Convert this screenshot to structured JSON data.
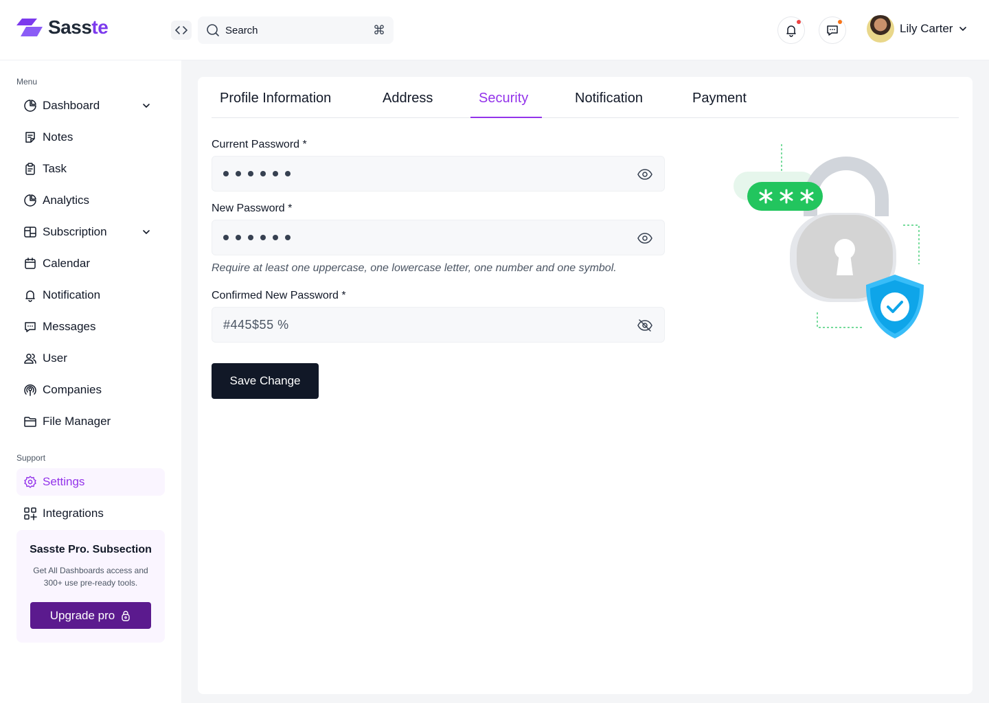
{
  "brand": {
    "name_part1": "Sass",
    "name_part2": "te"
  },
  "header": {
    "search_placeholder": "Search",
    "shortcut_symbol": "⌘",
    "user_name": "Lily Carter",
    "notification_dot_color": "#ef4444",
    "message_dot_color": "#f97316"
  },
  "sidebar": {
    "menu_label": "Menu",
    "items": [
      {
        "label": "Dashboard",
        "icon": "pie-chart-icon",
        "has_chevron": true
      },
      {
        "label": "Notes",
        "icon": "note-icon"
      },
      {
        "label": "Task",
        "icon": "clipboard-icon"
      },
      {
        "label": "Analytics",
        "icon": "pie-chart-icon"
      },
      {
        "label": "Subscription",
        "icon": "layout-icon",
        "has_chevron": true
      },
      {
        "label": "Calendar",
        "icon": "calendar-icon"
      },
      {
        "label": "Notification",
        "icon": "bell-icon"
      },
      {
        "label": "Messages",
        "icon": "chat-icon"
      },
      {
        "label": "User",
        "icon": "users-icon"
      },
      {
        "label": "Companies",
        "icon": "podcast-icon"
      },
      {
        "label": "File Manager",
        "icon": "folder-icon"
      }
    ],
    "support_label": "Support",
    "support_items": [
      {
        "label": "Settings",
        "icon": "gear-icon",
        "active": true
      },
      {
        "label": "Integrations",
        "icon": "grid-plus-icon"
      }
    ],
    "promo": {
      "title": "Sasste Pro. Subsection",
      "text": "Get All Dashboards access and 300+ use pre-ready tools.",
      "button_label": "Upgrade pro"
    }
  },
  "tabs": [
    {
      "label": "Profile Information"
    },
    {
      "label": "Address"
    },
    {
      "label": "Security",
      "active": true
    },
    {
      "label": "Notification"
    },
    {
      "label": "Payment"
    }
  ],
  "form": {
    "current_password_label": "Current Password *",
    "new_password_label": "New Password *",
    "hint": "Require at least one uppercase, one lowercase letter, one number and one symbol.",
    "confirm_password_label": "Confirmed New Password *",
    "confirm_password_value": "#445$55 %",
    "save_label": "Save Change"
  },
  "colors": {
    "accent": "#9333ea",
    "primary_dark": "#111827",
    "upgrade": "#5b1a8e"
  }
}
